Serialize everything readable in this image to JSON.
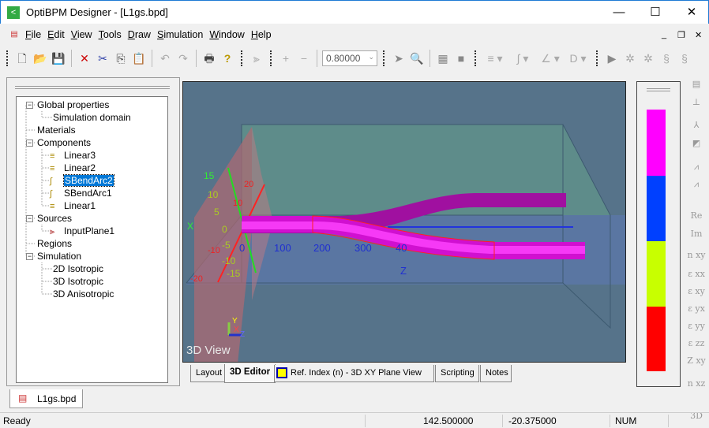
{
  "window": {
    "title": "OptiBPM Designer  - [L1gs.bpd]",
    "minimize": "—",
    "maximize": "☐",
    "close": "✕"
  },
  "menu": {
    "items": [
      {
        "label": "File",
        "u": "F",
        "rest": "ile"
      },
      {
        "label": "Edit",
        "u": "E",
        "rest": "dit"
      },
      {
        "label": "View",
        "u": "V",
        "rest": "iew"
      },
      {
        "label": "Tools",
        "u": "T",
        "rest": "ools"
      },
      {
        "label": "Draw",
        "u": "D",
        "rest": "raw"
      },
      {
        "label": "Simulation",
        "u": "S",
        "rest": "imulation"
      },
      {
        "label": "Window",
        "u": "W",
        "rest": "indow"
      },
      {
        "label": "Help",
        "u": "H",
        "rest": "elp"
      }
    ],
    "mdi_min": "_",
    "mdi_restore": "❐",
    "mdi_close": "✕"
  },
  "toolbar": {
    "zoom_value": "0.80000"
  },
  "tree": {
    "items": [
      {
        "label": "Global properties"
      },
      {
        "label": "Simulation domain"
      },
      {
        "label": "Materials"
      },
      {
        "label": "Components"
      },
      {
        "label": "Linear3"
      },
      {
        "label": "Linear2"
      },
      {
        "label": "SBendArc2"
      },
      {
        "label": "SBendArc1"
      },
      {
        "label": "Linear1"
      },
      {
        "label": "Sources"
      },
      {
        "label": "InputPlane1"
      },
      {
        "label": "Regions"
      },
      {
        "label": "Simulation"
      },
      {
        "label": "2D Isotropic"
      },
      {
        "label": "3D Isotropic"
      },
      {
        "label": "3D Anisotropic"
      }
    ],
    "selected": "SBendArc2"
  },
  "view3d": {
    "label": "3D View",
    "z_ticks": [
      "0",
      "100",
      "200",
      "300",
      "40"
    ],
    "z_axis": "Z",
    "y_ticks": [
      "15",
      "10",
      "5",
      "0",
      "-5",
      "-10",
      "-15"
    ],
    "x_ticks": [
      "20",
      "10",
      "-10",
      "-20"
    ],
    "x_axis": "X",
    "triad": {
      "y": "Y",
      "x": "X",
      "z": "Z"
    }
  },
  "tabs": [
    {
      "label": "Layout"
    },
    {
      "label": "3D Editor",
      "active": true
    },
    {
      "label": "Ref. Index (n) - 3D XY Plane View"
    },
    {
      "label": "Scripting"
    },
    {
      "label": "Notes"
    }
  ],
  "colorbar": {
    "colors": [
      "#ff00ff",
      "#0040ff",
      "#c8ff00",
      "#ff0000"
    ]
  },
  "right_toolbar": [
    "Re",
    "Im",
    "n xy",
    "ε xx",
    "ε xy",
    "ε yx",
    "ε yy",
    "ε zz",
    "Z xy",
    "n xz",
    "3D"
  ],
  "doc_tab": "L1gs.bpd",
  "status": {
    "text": "Ready",
    "x": "142.500000",
    "y": "-20.375000",
    "num": "NUM"
  }
}
